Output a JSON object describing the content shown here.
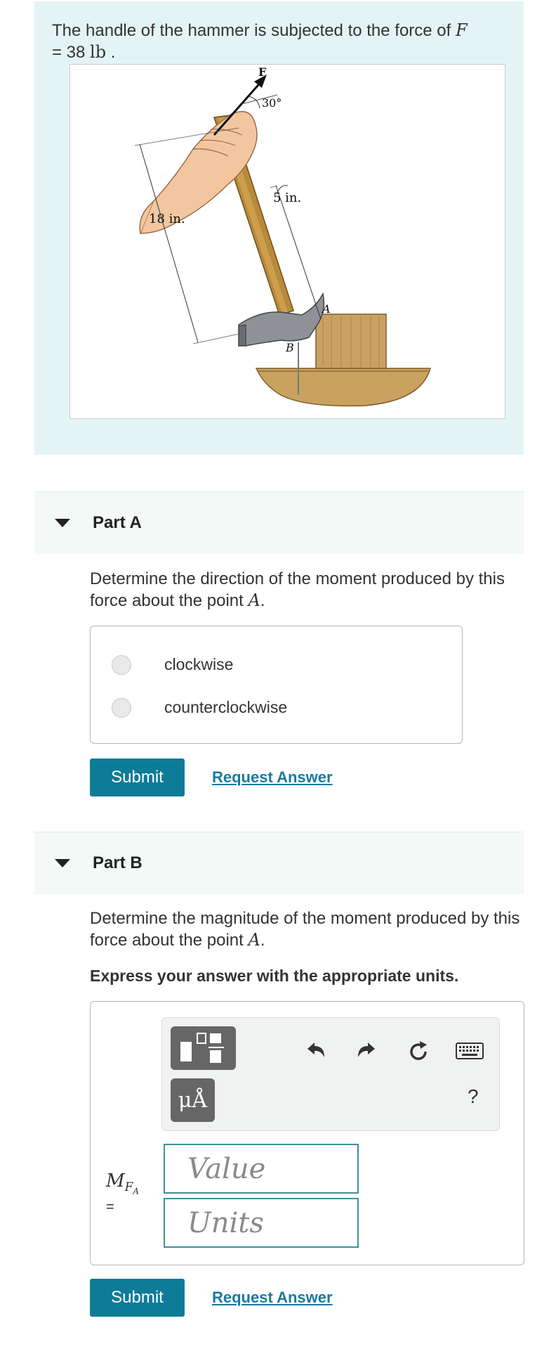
{
  "intro": {
    "text_before": "The handle of the hammer is subjected to the force of ",
    "force_symbol": "F",
    "text_eq": "= 38 ",
    "unit": "lb",
    "text_end": " ."
  },
  "figure": {
    "force_label": "F",
    "angle_label": "30°",
    "dim_5": "5 in.",
    "dim_18": "18 in.",
    "point_a": "A",
    "point_b": "B"
  },
  "part_a": {
    "label": "Part A",
    "question_before": "Determine the direction of the moment produced by this force about the point ",
    "point": "A",
    "question_after": ".",
    "choices": [
      "clockwise",
      "counterclockwise"
    ],
    "submit": "Submit",
    "request": "Request Answer"
  },
  "part_b": {
    "label": "Part B",
    "question_before": "Determine the magnitude of the moment produced by this force about the point ",
    "point": "A",
    "question_after": ".",
    "instruction": "Express your answer with the appropriate units.",
    "answer_label_main": "M",
    "answer_label_sub": "F",
    "answer_label_subsub": "A",
    "equals": "=",
    "value_placeholder": "Value",
    "units_placeholder": "Units",
    "mu_button": "μÅ",
    "help": "?",
    "submit": "Submit",
    "request": "Request Answer"
  },
  "colors": {
    "accent": "#0e7c98",
    "link": "#1a7aa0",
    "intro_bg": "#e4f4f5",
    "part_header_bg": "#f3f9f7"
  },
  "icons": [
    "undo-icon",
    "redo-icon",
    "reset-icon",
    "keyboard-icon",
    "templates-icon",
    "units-icon"
  ]
}
